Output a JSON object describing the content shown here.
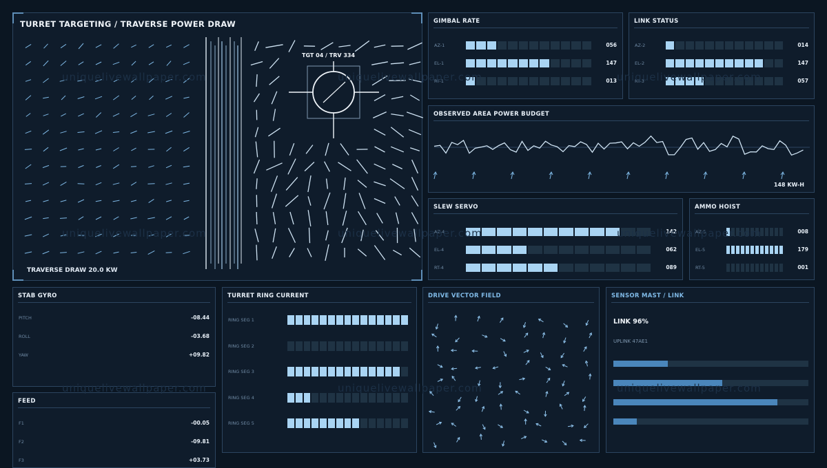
{
  "main": {
    "title": "TURRET TARGETING / TRAVERSE POWER DRAW",
    "target_label": "TGT 04 / TRV 334",
    "footer": "TRAVERSE DRAW 20.0 KW"
  },
  "watermark": "uniquelivewallpaper.com",
  "gimbal": {
    "title": "GIMBAL RATE",
    "rows": [
      {
        "label": "AZ-1",
        "value": "056",
        "level": 0.25
      },
      {
        "label": "EL-1",
        "value": "147",
        "level": 0.65
      },
      {
        "label": "RT-1",
        "value": "013",
        "level": 0.08
      }
    ]
  },
  "link_status": {
    "title": "LINK STATUS",
    "rows": [
      {
        "label": "AZ-2",
        "value": "014",
        "level": 0.08
      },
      {
        "label": "EL-2",
        "value": "147",
        "level": 0.85
      },
      {
        "label": "RT-3",
        "value": "057",
        "level": 0.33
      }
    ]
  },
  "power_budget": {
    "title": "OBSERVED AREA POWER BUDGET",
    "value": "148 KW-H"
  },
  "slew_servo": {
    "title": "SLEW SERVO",
    "rows": [
      {
        "label": "AZ-4",
        "value": "142",
        "level": 0.8
      },
      {
        "label": "EL-4",
        "value": "062",
        "level": 0.33
      },
      {
        "label": "RT-4",
        "value": "089",
        "level": 0.5
      }
    ]
  },
  "ammo_hoist": {
    "title": "AMMO HOIST",
    "rows": [
      {
        "label": "AZ-5",
        "value": "008",
        "level": 0.1
      },
      {
        "label": "EL-5",
        "value": "179",
        "level": 1.0
      },
      {
        "label": "RT-5",
        "value": "001",
        "level": 0.0
      }
    ]
  },
  "stab_gyro": {
    "title": "STAB GYRO",
    "rows": [
      {
        "label": "PITCH",
        "value": "-08.44"
      },
      {
        "label": "ROLL",
        "value": "-03.68"
      },
      {
        "label": "YAW",
        "value": "+09.82"
      }
    ]
  },
  "feed": {
    "title": "FEED",
    "rows": [
      {
        "label": "F1",
        "value": "-00.05"
      },
      {
        "label": "F2",
        "value": "-09.81"
      },
      {
        "label": "F3",
        "value": "+03.73"
      }
    ]
  },
  "ring_current": {
    "title": "TURRET RING CURRENT",
    "rows": [
      {
        "label": "RING SEG 1",
        "level": 1.0
      },
      {
        "label": "RING SEG 2",
        "level": 0.0
      },
      {
        "label": "RING SEG 3",
        "level": 0.93
      },
      {
        "label": "RING SEG 4",
        "level": 0.2
      },
      {
        "label": "RING SEG 5",
        "level": 0.62
      }
    ]
  },
  "drive_field": {
    "title": "DRIVE VECTOR FIELD"
  },
  "sensor_mast": {
    "title": "SENSOR MAST / LINK",
    "link": "LINK 96%",
    "uplink": "UPLINK 47AE1",
    "bars": [
      0.28,
      0.56,
      0.84,
      0.12
    ]
  },
  "colors": {
    "background": "#0b1622",
    "panel": "#0f1c2b",
    "border": "#2c4560",
    "segment_on": "#a9d4f3",
    "segment_off": "#1f3344",
    "accent": "#7fb9e6",
    "bar_fill": "#4a86bb"
  }
}
